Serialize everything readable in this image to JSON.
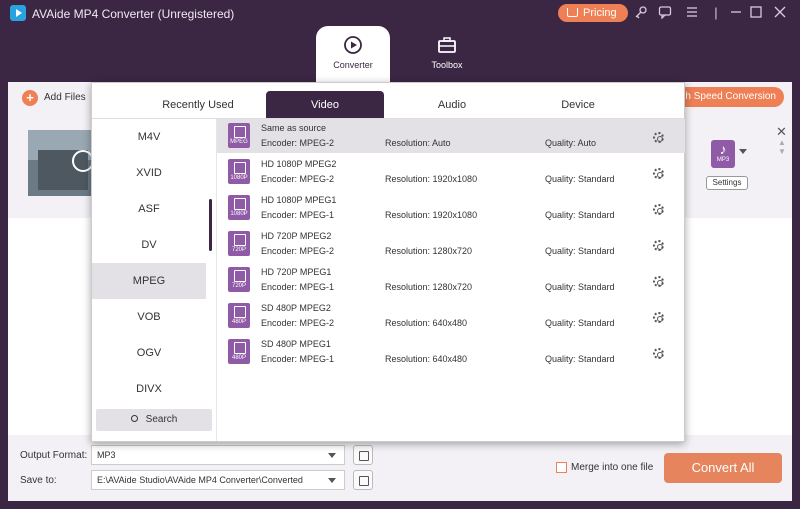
{
  "app": {
    "title": "AVAide MP4 Converter (Unregistered)",
    "pricing_label": "Pricing"
  },
  "nav": {
    "tabs": [
      {
        "label": "Converter",
        "icon": "converter-icon",
        "active": true
      },
      {
        "label": "Toolbox",
        "icon": "toolbox-icon",
        "active": false
      }
    ]
  },
  "toolbar": {
    "add_files_label": "Add Files",
    "high_speed_label": "gh Speed Conversion"
  },
  "file_row": {
    "output_icon_label": "MP3",
    "settings_label": "Settings"
  },
  "popup": {
    "tabs": [
      {
        "label": "Recently Used",
        "active": false
      },
      {
        "label": "Video",
        "active": true
      },
      {
        "label": "Audio",
        "active": false
      },
      {
        "label": "Device",
        "active": false
      }
    ],
    "formats": [
      "M4V",
      "XVID",
      "ASF",
      "DV",
      "MPEG",
      "VOB",
      "OGV",
      "DIVX"
    ],
    "selected_format": "MPEG",
    "search_label": "Search",
    "presets": [
      {
        "badge": "MPEG",
        "name": "Same as source",
        "encoder": "Encoder: MPEG-2",
        "resolution": "Resolution: Auto",
        "quality": "Quality: Auto",
        "selected": true
      },
      {
        "badge": "1080P",
        "name": "HD 1080P MPEG2",
        "encoder": "Encoder: MPEG-2",
        "resolution": "Resolution: 1920x1080",
        "quality": "Quality: Standard",
        "selected": false
      },
      {
        "badge": "1080P",
        "name": "HD 1080P MPEG1",
        "encoder": "Encoder: MPEG-1",
        "resolution": "Resolution: 1920x1080",
        "quality": "Quality: Standard",
        "selected": false
      },
      {
        "badge": "720P",
        "name": "HD 720P MPEG2",
        "encoder": "Encoder: MPEG-2",
        "resolution": "Resolution: 1280x720",
        "quality": "Quality: Standard",
        "selected": false
      },
      {
        "badge": "720P",
        "name": "HD 720P MPEG1",
        "encoder": "Encoder: MPEG-1",
        "resolution": "Resolution: 1280x720",
        "quality": "Quality: Standard",
        "selected": false
      },
      {
        "badge": "480P",
        "name": "SD 480P MPEG2",
        "encoder": "Encoder: MPEG-2",
        "resolution": "Resolution: 640x480",
        "quality": "Quality: Standard",
        "selected": false
      },
      {
        "badge": "480P",
        "name": "SD 480P MPEG1",
        "encoder": "Encoder: MPEG-1",
        "resolution": "Resolution: 640x480",
        "quality": "Quality: Standard",
        "selected": false
      }
    ]
  },
  "bottom": {
    "output_format_label": "Output Format:",
    "output_format_value": "MP3",
    "save_to_label": "Save to:",
    "save_to_value": "E:\\AVAide Studio\\AVAide MP4 Converter\\Converted",
    "merge_label": "Merge into one file",
    "merge_checked": false,
    "convert_all_label": "Convert All"
  },
  "colors": {
    "brand_dark": "#3b2644",
    "accent_orange": "#ef7f55",
    "format_icon_purple": "#8f5aa6"
  }
}
